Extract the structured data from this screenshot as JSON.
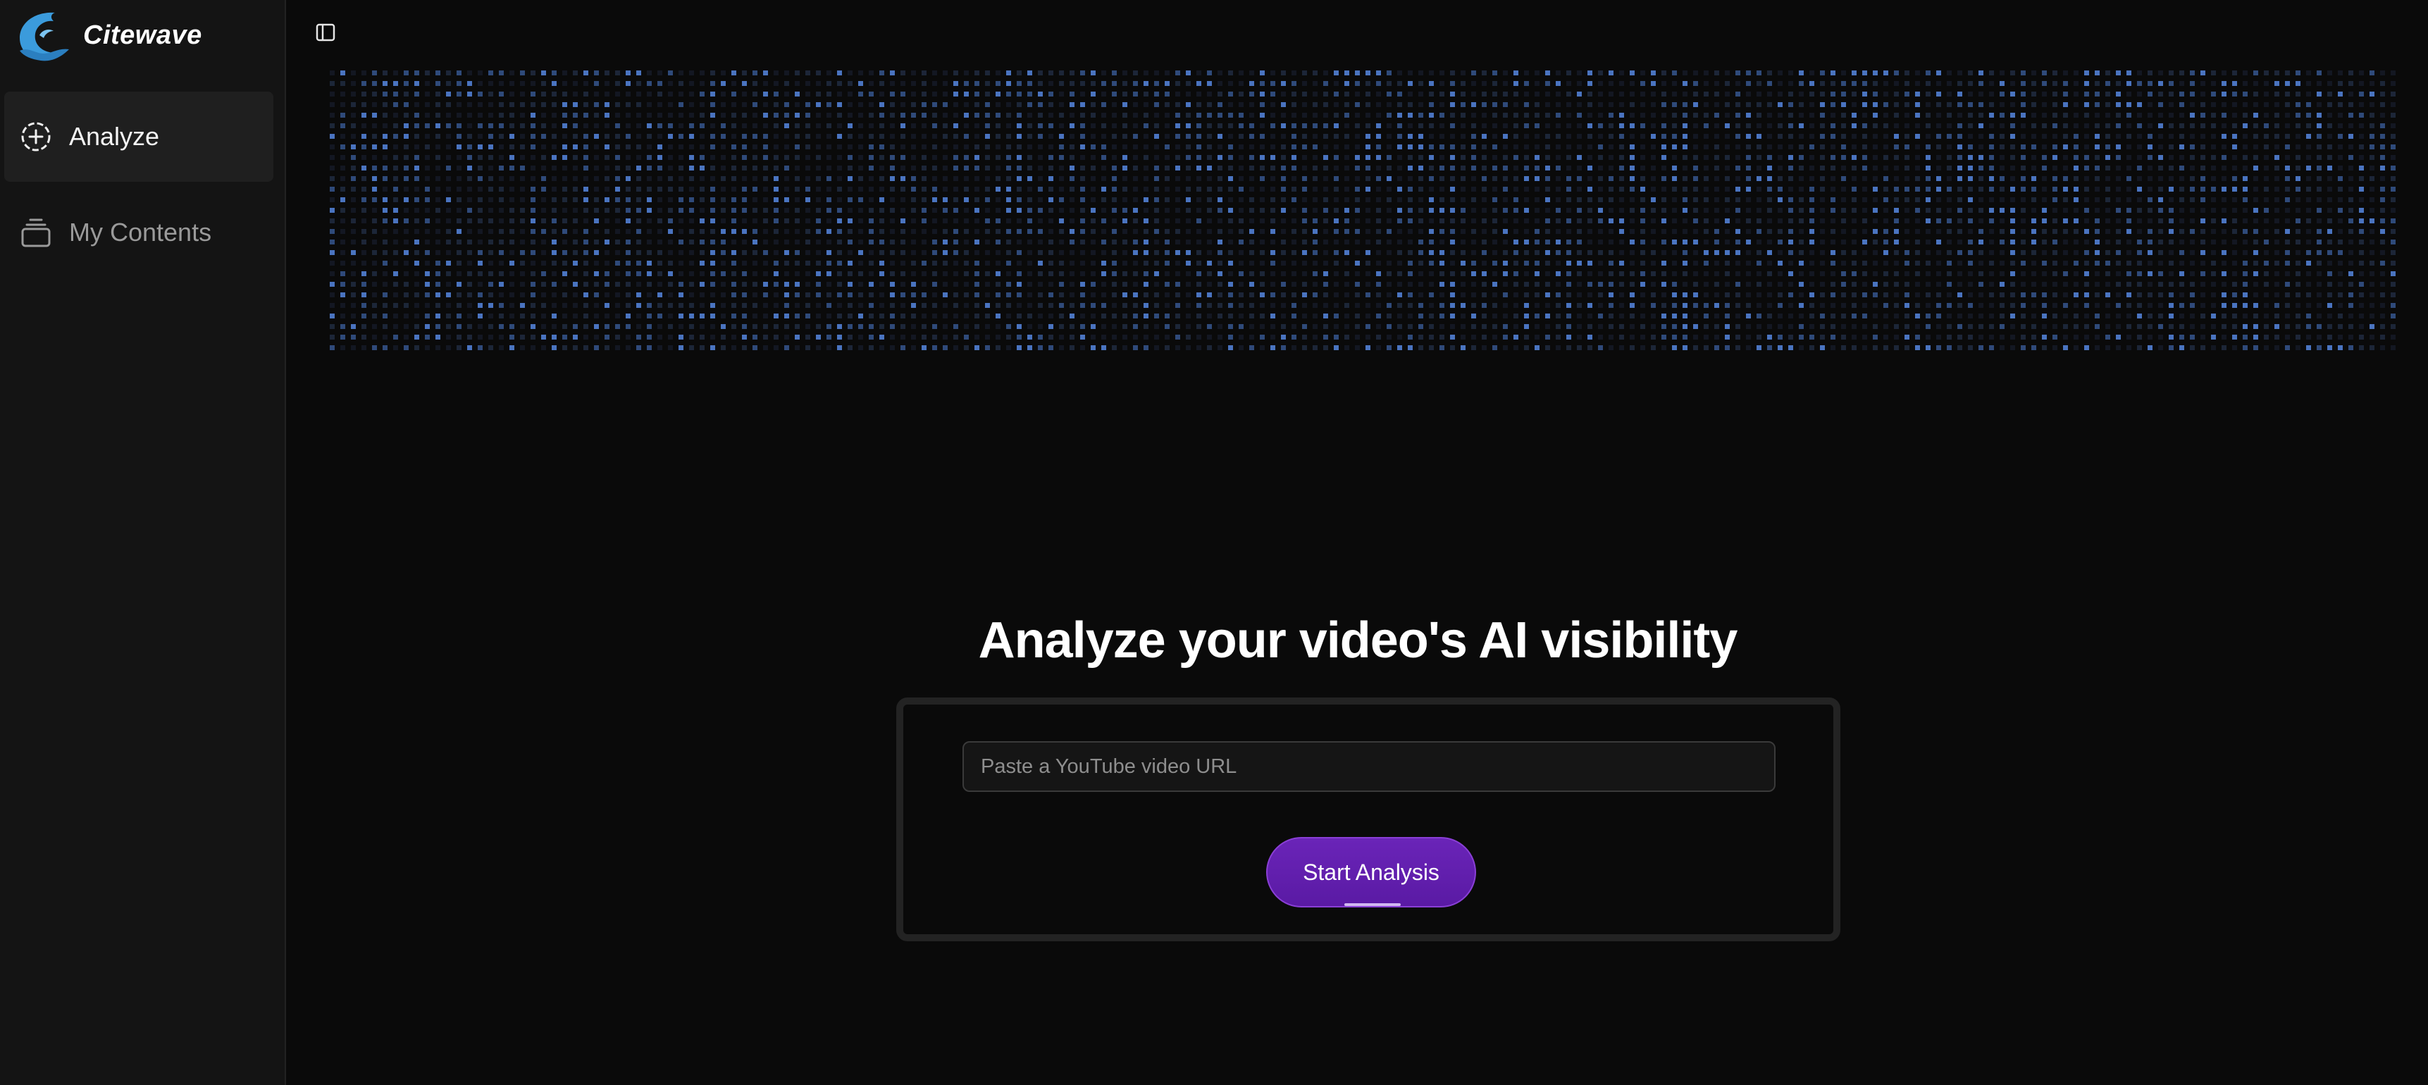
{
  "brand": {
    "name": "Citewave",
    "logo_icon": "wave-logo-icon",
    "color": "#3b9bdc"
  },
  "sidebar": {
    "items": [
      {
        "label": "Analyze",
        "icon": "plus-circle-icon",
        "active": true
      },
      {
        "label": "My Contents",
        "icon": "stack-icon",
        "active": false
      }
    ]
  },
  "header": {
    "toggle_icon": "sidebar-toggle-icon"
  },
  "main": {
    "title": "Analyze your video's AI visibility",
    "url_input": {
      "value": "",
      "placeholder": "Paste a YouTube video URL"
    },
    "start_button_label": "Start Analysis"
  },
  "colors": {
    "background": "#0a0a0a",
    "sidebar": "#141414",
    "accent_purple": "#5a1aa4",
    "dot_blue": "#4a74c0"
  }
}
